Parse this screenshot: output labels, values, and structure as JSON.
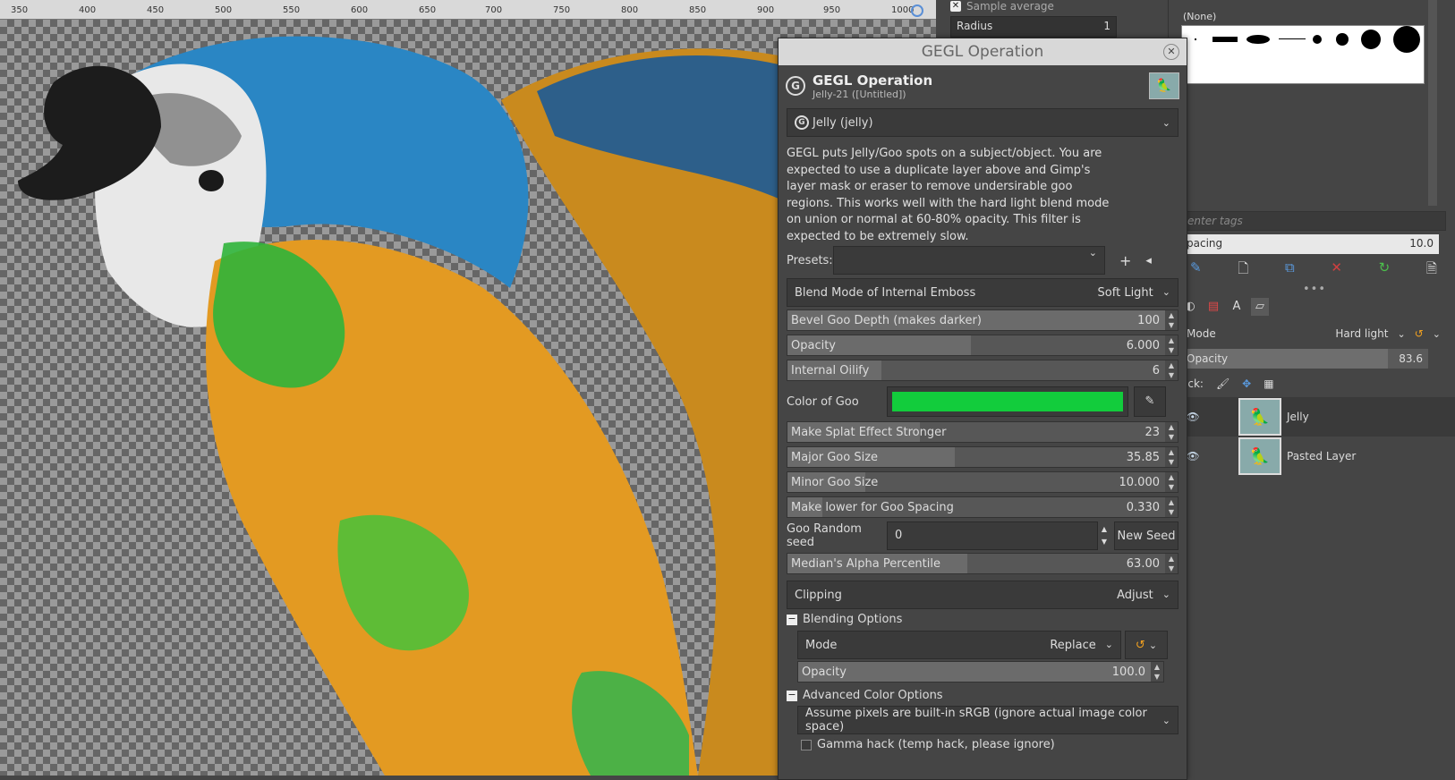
{
  "ruler": {
    "ticks": [
      "350",
      "400",
      "450",
      "500",
      "550",
      "600",
      "650",
      "700",
      "750",
      "800",
      "850",
      "900",
      "950",
      "1000"
    ]
  },
  "tool_options": {
    "sample_average": "Sample average",
    "radius_label": "Radius",
    "radius_value": "1"
  },
  "brushes": {
    "none_label": "(None)",
    "tags_placeholder": "enter tags",
    "spacing_label": "pacing",
    "spacing_value": "10.0"
  },
  "layers": {
    "mode_label": "Mode",
    "mode_value": "Hard light",
    "opacity_label": "Opacity",
    "opacity_value": "83.6",
    "opacity_fraction": 0.836,
    "lock_label": "ock:",
    "items": [
      {
        "name": "Jelly"
      },
      {
        "name": "Pasted Layer"
      }
    ]
  },
  "dialog": {
    "window_title": "GEGL Operation",
    "header_title": "GEGL Operation",
    "header_subtitle": "Jelly-21 ([Untitled])",
    "operation": "Jelly (jelly)",
    "description": "GEGL puts Jelly/Goo spots on a subject/object. You are expected to use a duplicate layer above and Gimp's layer mask or eraser to remove undersirable goo regions. This works well with the hard light blend mode on union or normal at 60-80% opacity. This filter is expected to be extremely slow.",
    "presets_label": "Presets:",
    "blend_emboss_label": "Blend Mode of Internal Emboss",
    "blend_emboss_value": "Soft Light",
    "sliders": [
      {
        "label": "Bevel Goo Depth (makes darker)",
        "value": "100",
        "fraction": 1.0
      },
      {
        "label": "Opacity",
        "value": "6.000",
        "fraction": 0.47
      },
      {
        "label": "Internal Oilify",
        "value": "6",
        "fraction": 0.24
      }
    ],
    "color_label": "Color of Goo",
    "color_value": "#12cc3c",
    "sliders2": [
      {
        "label": "Make Splat Effect Stronger",
        "value": "23",
        "fraction": 0.34
      },
      {
        "label": "Major Goo Size",
        "value": "35.85",
        "fraction": 0.43
      },
      {
        "label": "Minor Goo Size",
        "value": "10.000",
        "fraction": 0.2
      },
      {
        "label": "Make lower for Goo Spacing",
        "value": "0.330",
        "fraction": 0.09
      }
    ],
    "seed_label": "Goo Random seed",
    "seed_value": "0",
    "new_seed_label": "New Seed",
    "median_label": "Median's Alpha Percentile",
    "median_value": "63.00",
    "median_fraction": 0.46,
    "clipping_label": "Clipping",
    "clipping_value": "Adjust",
    "blending_options_label": "Blending Options",
    "mode_label": "Mode",
    "mode_value": "Replace",
    "opacity_label": "Opacity",
    "opacity_value": "100.0",
    "advanced_label": "Advanced Color Options",
    "assume_label": "Assume pixels are built-in sRGB (ignore actual image color space)",
    "gamma_label": "Gamma hack (temp hack, please ignore)"
  }
}
